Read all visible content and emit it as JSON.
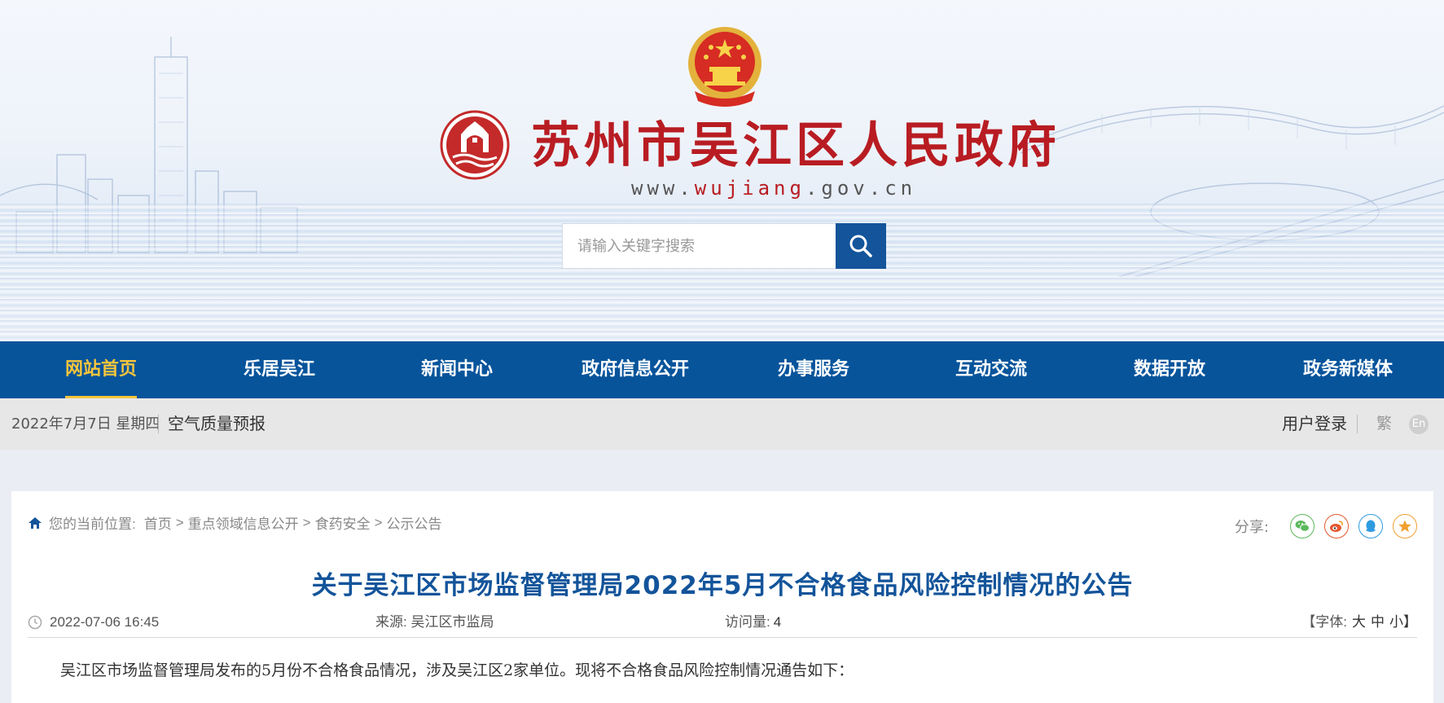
{
  "header": {
    "site_title": "苏州市吴江区人民政府",
    "url_prefix": "www.",
    "url_highlight": "wujiang",
    "url_suffix": ".gov.cn",
    "search_placeholder": "请输入关键字搜索",
    "brand_red": "#b81c22",
    "brand_blue": "#07549b"
  },
  "nav": {
    "items": [
      {
        "label": "网站首页",
        "active": true
      },
      {
        "label": "乐居吴江"
      },
      {
        "label": "新闻中心"
      },
      {
        "label": "政府信息公开"
      },
      {
        "label": "办事服务"
      },
      {
        "label": "互动交流"
      },
      {
        "label": "数据开放"
      },
      {
        "label": "政务新媒体"
      }
    ],
    "active_color": "#f7c53c"
  },
  "infobar": {
    "date": "2022年7月7日 星期四",
    "air_quality": "空气质量预报",
    "login": "用户登录",
    "traditional": "繁",
    "english": "En"
  },
  "breadcrumb": {
    "label": "您的当前位置:",
    "items": [
      "首页",
      "重点领域信息公开",
      "食药安全",
      "公示公告"
    ],
    "separator": ">"
  },
  "share": {
    "label": "分享:",
    "icons": [
      "wechat-icon",
      "weibo-icon",
      "qq-icon",
      "favorite-icon"
    ]
  },
  "article": {
    "title": "关于吴江区市场监督管理局2022年5月不合格食品风险控制情况的公告",
    "datetime": "2022-07-06 16:45",
    "source_label": "来源:",
    "source": "吴江区市监局",
    "visits_label": "访问量:",
    "visits": "4",
    "font_label": "【字体:",
    "font_large": "大",
    "font_medium": "中",
    "font_small": "小】",
    "paragraph": "吴江区市场监督管理局发布的5月份不合格食品情况，涉及吴江区2家单位。现将不合格食品风险控制情况通告如下："
  }
}
